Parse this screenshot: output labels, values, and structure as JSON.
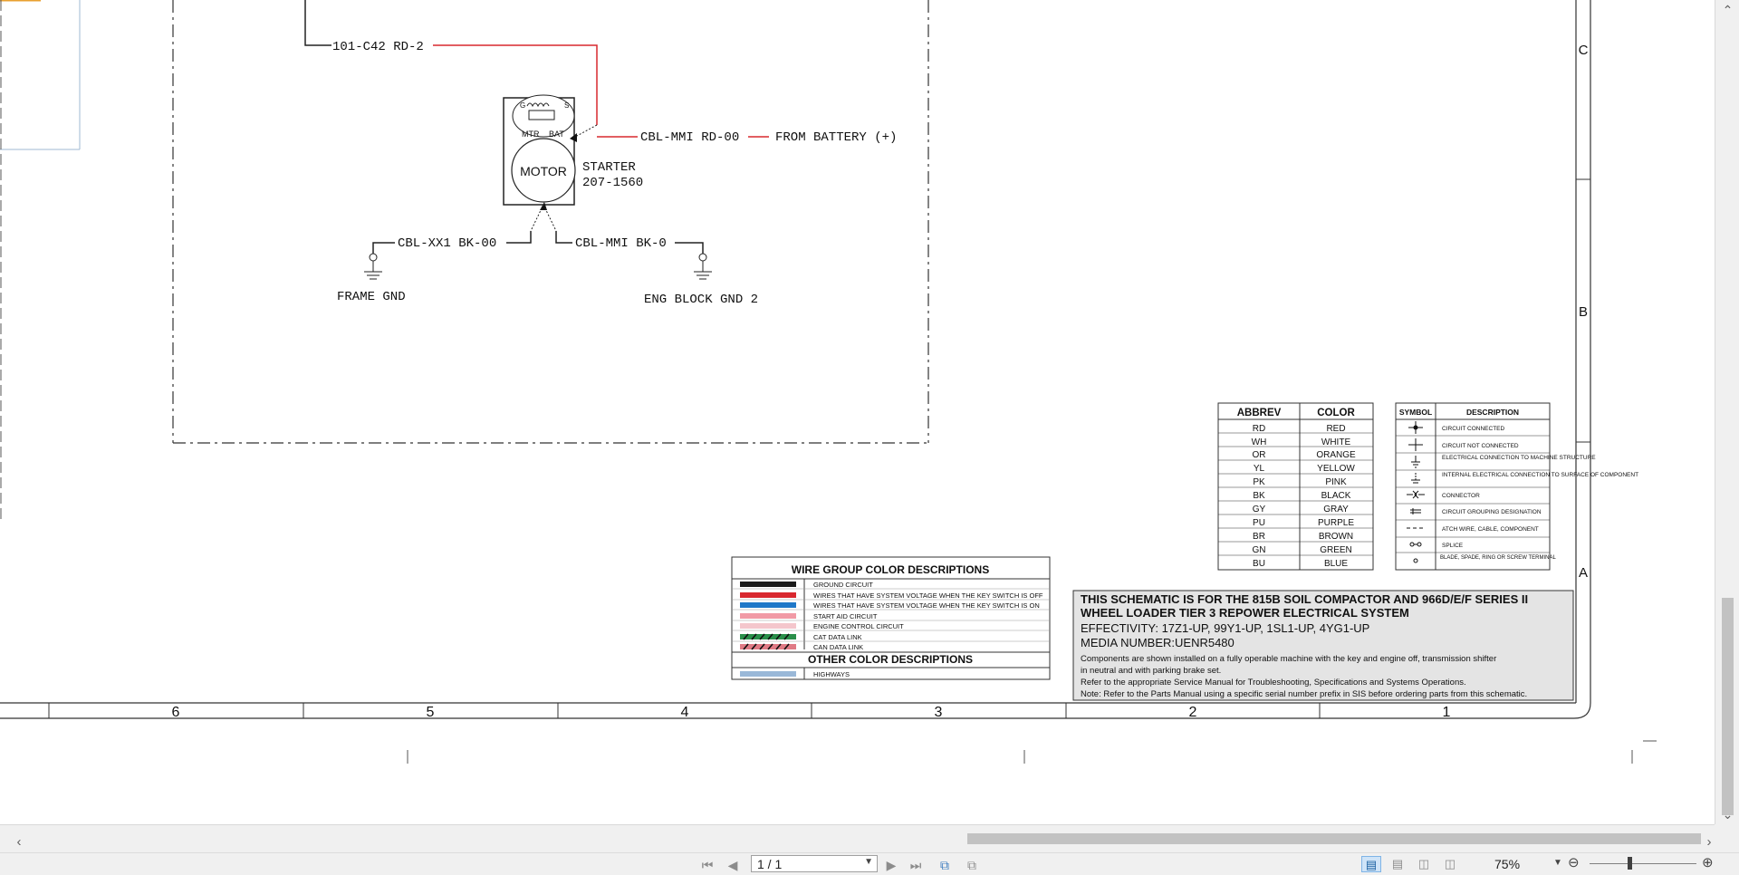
{
  "schematic": {
    "wires": {
      "battery_circuit": "101-C42 RD-2",
      "starter_feed": "CBL-MMI RD-00",
      "battery_source": "FROM BATTERY (+)",
      "frame_ground_wire": "CBL-XX1 BK-00",
      "block_ground_wire": "CBL-MMI BK-0"
    },
    "starter": {
      "motor_label": "MOTOR",
      "name": "STARTER",
      "part_number": "207-1560",
      "terminal_g": "G",
      "terminal_s": "S",
      "terminal_mtr": "MTR",
      "terminal_bat": "BAT"
    },
    "grounds": {
      "frame": "FRAME GND",
      "eng_block": "ENG BLOCK GND 2"
    },
    "zones_horizontal": [
      "6",
      "5",
      "4",
      "3",
      "2",
      "1"
    ],
    "zones_vertical": [
      "C",
      "B",
      "A"
    ],
    "wire_group_legend": {
      "title": "WIRE GROUP COLOR DESCRIPTIONS",
      "rows": [
        {
          "label": "GROUND CIRCUIT",
          "color": "#1a1a1a"
        },
        {
          "label": "WIRES THAT HAVE SYSTEM VOLTAGE WHEN THE KEY SWITCH IS OFF",
          "color": "#d9282f"
        },
        {
          "label": "WIRES THAT HAVE SYSTEM VOLTAGE WHEN THE KEY SWITCH IS ON",
          "color": "#1f78c8"
        },
        {
          "label": "START AID CIRCUIT",
          "color": "#f19aa6"
        },
        {
          "label": "ENGINE CONTROL CIRCUIT",
          "color": "#f4c6cc"
        },
        {
          "label": "CAT DATA LINK",
          "color": "#2a8f4a"
        },
        {
          "label": "CAN DATA LINK",
          "color": "#e07a85"
        }
      ],
      "other_title": "OTHER COLOR DESCRIPTIONS",
      "other_rows": [
        {
          "label": "HIGHWAYS",
          "color": "#9ab8d8"
        }
      ]
    },
    "color_abbrev_table": {
      "headers": [
        "ABBREV",
        "COLOR"
      ],
      "rows": [
        [
          "RD",
          "RED"
        ],
        [
          "WH",
          "WHITE"
        ],
        [
          "OR",
          "ORANGE"
        ],
        [
          "YL",
          "YELLOW"
        ],
        [
          "PK",
          "PINK"
        ],
        [
          "BK",
          "BLACK"
        ],
        [
          "GY",
          "GRAY"
        ],
        [
          "PU",
          "PURPLE"
        ],
        [
          "BR",
          "BROWN"
        ],
        [
          "GN",
          "GREEN"
        ],
        [
          "BU",
          "BLUE"
        ]
      ]
    },
    "symbol_table": {
      "headers": [
        "SYMBOL",
        "DESCRIPTION"
      ],
      "rows": [
        {
          "symbol": "dot-cross-icon",
          "description": "CIRCUIT CONNECTED"
        },
        {
          "symbol": "cross-icon",
          "description": "CIRCUIT NOT CONNECTED"
        },
        {
          "symbol": "ground-icon",
          "description": "ELECTRICAL CONNECTION TO MACHINE STRUCTURE"
        },
        {
          "symbol": "internal-ground-icon",
          "description": "INTERNAL ELECTRICAL CONNECTION TO SURFACE OF COMPONENT"
        },
        {
          "symbol": "connector-icon",
          "description": "CONNECTOR"
        },
        {
          "symbol": "grouping-icon",
          "description": "CIRCUIT GROUPING DESIGNATION"
        },
        {
          "symbol": "dash-icon",
          "description": "ATCH WIRE, CABLE, COMPONENT"
        },
        {
          "symbol": "splice-icon",
          "description": "SPLICE"
        },
        {
          "symbol": "terminal-icon",
          "description": "BLADE, SPADE, RING OR SCREW TERMINAL"
        }
      ]
    },
    "title_block": {
      "line1": "THIS SCHEMATIC IS FOR THE 815B SOIL COMPACTOR AND 966D/E/F SERIES II",
      "line2": "WHEEL LOADER TIER 3 REPOWER ELECTRICAL SYSTEM",
      "effectivity": "EFFECTIVITY: 17Z1-UP, 99Y1-UP, 1SL1-UP, 4YG1-UP",
      "media_number": "MEDIA NUMBER:UENR5480",
      "note1": "Components are shown installed on a fully operable machine with the key and engine off, transmission shifter",
      "note2": "in neutral and with parking brake set.",
      "note3": "Refer to the appropriate Service Manual for Troubleshooting, Specifications and Systems Operations.",
      "note4": "Note: Refer to the Parts Manual using a specific serial number prefix in SIS before ordering parts from this schematic."
    }
  },
  "statusbar": {
    "page_indicator": "1 / 1",
    "zoom": "75%"
  },
  "icons": {
    "first_page": "⏮",
    "prev_page": "◀",
    "next_page": "▶",
    "last_page": "⏭",
    "zoom_out": "⊖",
    "zoom_in": "⊕"
  }
}
